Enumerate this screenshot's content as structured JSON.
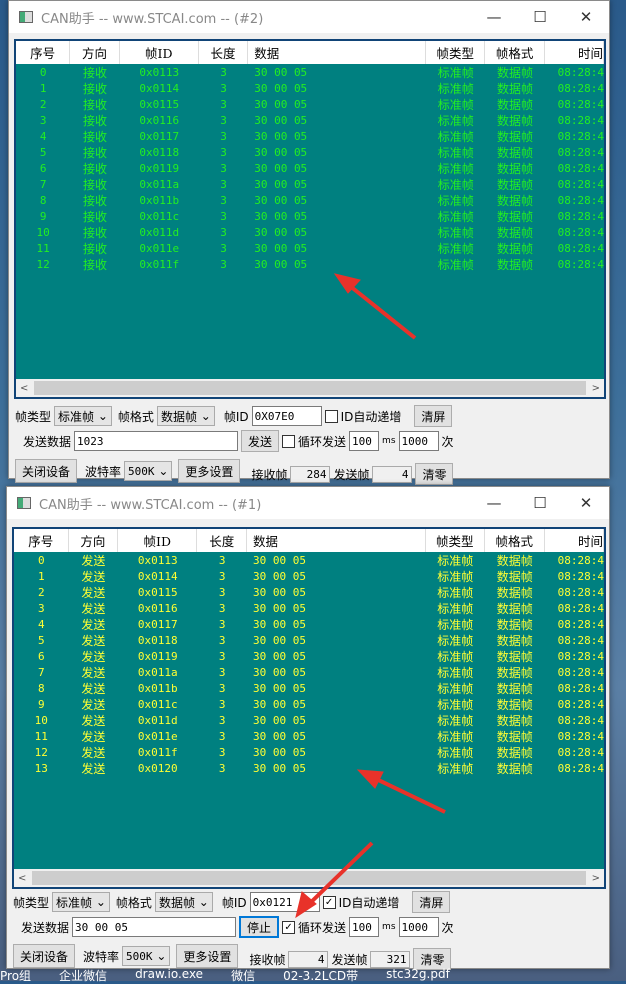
{
  "colors": {
    "table_bg": "#008080",
    "recv_text": "#22ee22",
    "send_text": "#ffff33",
    "arrow": "#e8322a"
  },
  "columns": [
    "序号",
    "方向",
    "帧ID",
    "长度",
    "数据",
    "帧类型",
    "帧格式",
    "时间"
  ],
  "windows": [
    {
      "title": "CAN助手 -- www.STCAI.com -- (#2)",
      "dir": "接收",
      "time": "08:28:4",
      "rows": [
        [
          "0",
          "0x0113"
        ],
        [
          "1",
          "0x0114"
        ],
        [
          "2",
          "0x0115"
        ],
        [
          "3",
          "0x0116"
        ],
        [
          "4",
          "0x0117"
        ],
        [
          "5",
          "0x0118"
        ],
        [
          "6",
          "0x0119"
        ],
        [
          "7",
          "0x011a"
        ],
        [
          "8",
          "0x011b"
        ],
        [
          "9",
          "0x011c"
        ],
        [
          "10",
          "0x011d"
        ],
        [
          "11",
          "0x011e"
        ],
        [
          "12",
          "0x011f"
        ]
      ],
      "len": "3",
      "data": "30 00 05",
      "ftype": "标准帧",
      "fformat": "数据帧",
      "controls": {
        "frame_type_label": "帧类型",
        "frame_type": "标准帧",
        "frame_format_label": "帧格式",
        "frame_format": "数据帧",
        "id_label": "帧ID",
        "id_value": "0X07E0",
        "id_auto_label": "ID自动递增",
        "id_auto": false,
        "clear_screen": "清屏",
        "send_data_label": "发送数据",
        "send_data": "1023",
        "send_btn": "发送",
        "loop_label": "循环发送",
        "loop": false,
        "interval": "100",
        "ms": "ms",
        "count": "1000",
        "times": "次",
        "close_device": "关闭设备",
        "baud_label": "波特率",
        "baud": "500K",
        "more": "更多设置",
        "recv_label": "接收帧",
        "recv_count": "284",
        "sent_label": "发送帧",
        "sent_count": "4",
        "zero": "清零"
      }
    },
    {
      "title": "CAN助手 -- www.STCAI.com -- (#1)",
      "dir": "发送",
      "time": "08:28:4",
      "rows": [
        [
          "0",
          "0x0113"
        ],
        [
          "1",
          "0x0114"
        ],
        [
          "2",
          "0x0115"
        ],
        [
          "3",
          "0x0116"
        ],
        [
          "4",
          "0x0117"
        ],
        [
          "5",
          "0x0118"
        ],
        [
          "6",
          "0x0119"
        ],
        [
          "7",
          "0x011a"
        ],
        [
          "8",
          "0x011b"
        ],
        [
          "9",
          "0x011c"
        ],
        [
          "10",
          "0x011d"
        ],
        [
          "11",
          "0x011e"
        ],
        [
          "12",
          "0x011f"
        ],
        [
          "13",
          "0x0120"
        ]
      ],
      "len": "3",
      "data": "30 00 05",
      "ftype": "标准帧",
      "fformat": "数据帧",
      "controls": {
        "frame_type_label": "帧类型",
        "frame_type": "标准帧",
        "frame_format_label": "帧格式",
        "frame_format": "数据帧",
        "id_label": "帧ID",
        "id_value": "0x0121",
        "id_auto_label": "ID自动递增",
        "id_auto": true,
        "clear_screen": "清屏",
        "send_data_label": "发送数据",
        "send_data": "30 00 05",
        "send_btn": "停止",
        "loop_label": "循环发送",
        "loop": true,
        "interval": "100",
        "ms": "ms",
        "count": "1000",
        "times": "次",
        "close_device": "关闭设备",
        "baud_label": "波特率",
        "baud": "500K",
        "more": "更多设置",
        "recv_label": "接收帧",
        "recv_count": "4",
        "sent_label": "发送帧",
        "sent_count": "321",
        "zero": "清零"
      }
    }
  ],
  "taskbar": [
    "Pro组",
    "企业微信",
    "draw.io.exe",
    "微信",
    "02-3.2LCD带",
    "stc32g.pdf"
  ]
}
